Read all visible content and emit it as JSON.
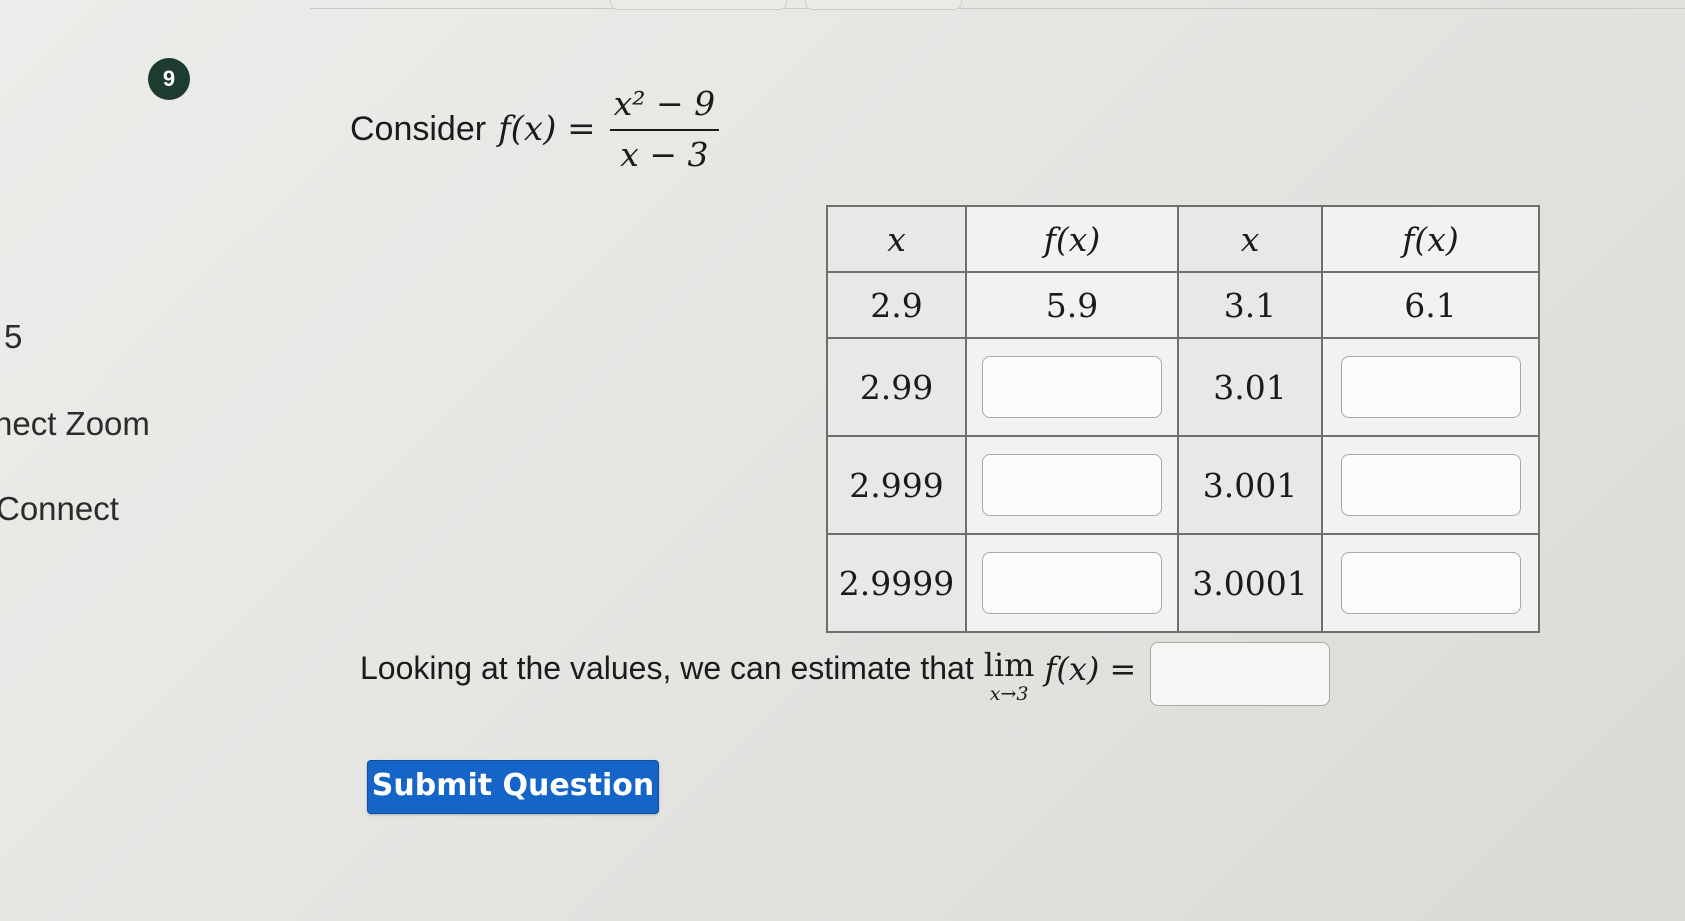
{
  "question": {
    "number": "9",
    "prompt_text": "Consider",
    "function_lhs": "f(x) =",
    "fraction_numerator": "x² − 9",
    "fraction_denominator": "x − 3"
  },
  "sidebar_fragments": [
    "5",
    "nect Zoom",
    "Connect"
  ],
  "table": {
    "headers": [
      "x",
      "f(x)",
      "x",
      "f(x)"
    ],
    "rows": [
      {
        "x_left": "2.9",
        "f_left": "5.9",
        "x_right": "3.1",
        "f_right": "6.1"
      },
      {
        "x_left": "2.99",
        "f_left": "",
        "x_right": "3.01",
        "f_right": ""
      },
      {
        "x_left": "2.999",
        "f_left": "",
        "x_right": "3.001",
        "f_right": ""
      },
      {
        "x_left": "2.9999",
        "f_left": "",
        "x_right": "3.0001",
        "f_right": ""
      }
    ]
  },
  "estimate": {
    "text": "Looking at the values, we can estimate that",
    "lim_word": "lim",
    "lim_sub": "x→3",
    "fx_eq": "f(x) =",
    "answer": ""
  },
  "submit": {
    "label": "Submit Question",
    "color": "#1565c9"
  }
}
